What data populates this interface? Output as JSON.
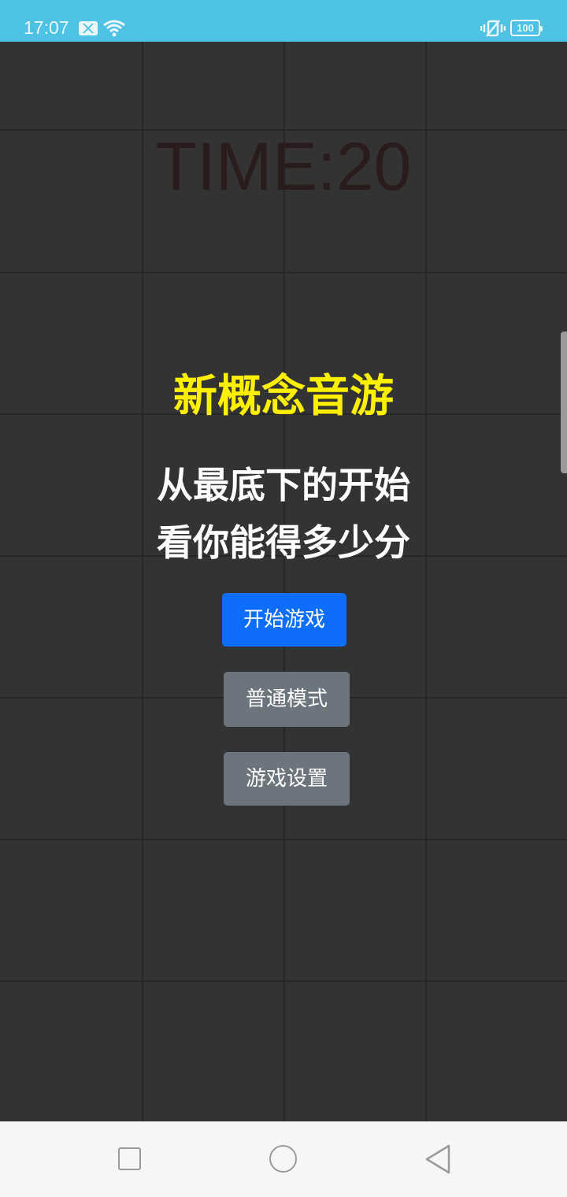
{
  "status_bar": {
    "time": "17:07",
    "battery": "100",
    "icons": [
      "mail-icon",
      "wifi-icon",
      "vibrate-icon",
      "battery-icon"
    ],
    "background": "#4dc2e4"
  },
  "game": {
    "timer": "TIME:20",
    "title": "新概念音游",
    "subtitle_line1": "从最底下的开始",
    "subtitle_line2": "看你能得多少分",
    "title_color": "#fff000",
    "background": "#333333"
  },
  "buttons": {
    "start": "开始游戏",
    "mode": "普通模式",
    "settings": "游戏设置",
    "primary_color": "#0d6efd",
    "secondary_color": "#6c757d"
  },
  "nav_bar": {
    "icons": [
      "recent-apps-icon",
      "home-icon",
      "back-icon"
    ]
  }
}
